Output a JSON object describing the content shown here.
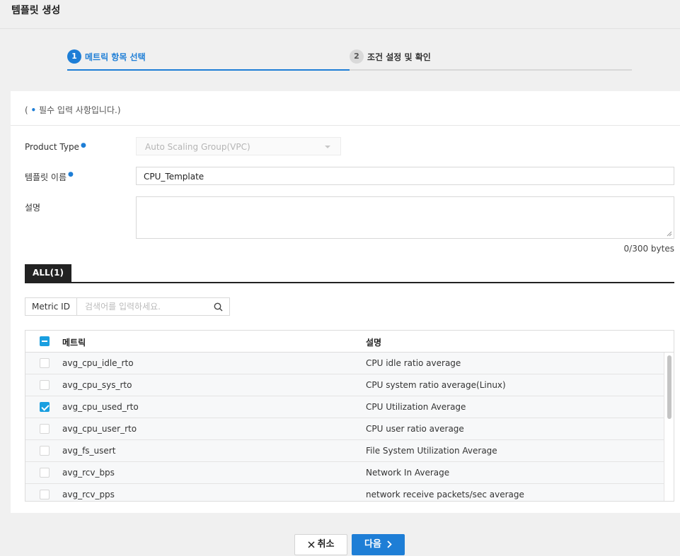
{
  "page": {
    "title": "템플릿 생성"
  },
  "steps": [
    {
      "num": "1",
      "label": "메트릭 항목 선택"
    },
    {
      "num": "2",
      "label": "조건 설정 및 확인"
    }
  ],
  "form": {
    "required_note_open": "(",
    "required_note_text": "필수 입력 사항입니다.)",
    "product_type_label": "Product Type",
    "product_type_value": "Auto Scaling Group(VPC)",
    "template_name_label": "템플릿 이름",
    "template_name_value": "CPU_Template",
    "description_label": "설명",
    "description_value": "",
    "byte_count": "0/300 bytes"
  },
  "tabs": [
    {
      "label": "ALL(1)"
    }
  ],
  "search": {
    "select_label": "Metric ID",
    "placeholder": "검색어를 입력하세요."
  },
  "table": {
    "headers": {
      "metric": "메트릭",
      "description": "설명"
    },
    "rows": [
      {
        "metric": "avg_cpu_idle_rto",
        "description": "CPU idle ratio average",
        "checked": false
      },
      {
        "metric": "avg_cpu_sys_rto",
        "description": "CPU system ratio average(Linux)",
        "checked": false
      },
      {
        "metric": "avg_cpu_used_rto",
        "description": "CPU Utilization Average",
        "checked": true
      },
      {
        "metric": "avg_cpu_user_rto",
        "description": "CPU user ratio average",
        "checked": false
      },
      {
        "metric": "avg_fs_usert",
        "description": "File System Utilization Average",
        "checked": false
      },
      {
        "metric": "avg_rcv_bps",
        "description": "Network In Average",
        "checked": false
      },
      {
        "metric": "avg_rcv_pps",
        "description": "network receive packets/sec average",
        "checked": false
      }
    ]
  },
  "buttons": {
    "cancel": "취소",
    "next": "다음"
  },
  "colors": {
    "accent": "#1e7ed6",
    "checkbox": "#1a9fe0"
  }
}
